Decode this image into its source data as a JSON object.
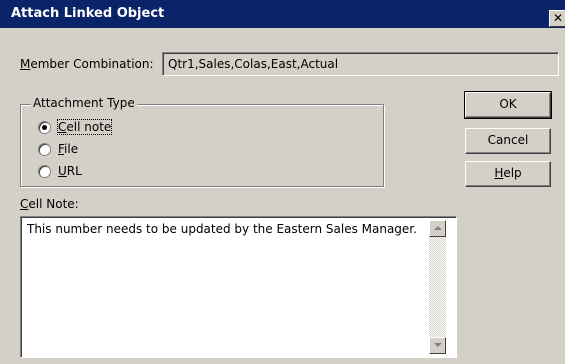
{
  "window": {
    "title": "Attach Linked Object",
    "close_glyph": "✕"
  },
  "member": {
    "label_mnemonic": "M",
    "label_rest": "ember Combination:",
    "value": "Qtr1,Sales,Colas,East,Actual"
  },
  "attachment": {
    "group_label": "Attachment Type",
    "options": [
      {
        "mnemonic": "C",
        "rest": "ell note",
        "selected": true
      },
      {
        "mnemonic": "F",
        "rest": "ile",
        "selected": false
      },
      {
        "mnemonic": "U",
        "rest": "RL",
        "selected": false
      }
    ]
  },
  "buttons": {
    "ok": "OK",
    "cancel": "Cancel",
    "help_mnemonic": "H",
    "help_rest": "elp"
  },
  "note": {
    "label_mnemonic": "C",
    "label_rest": "ell Note:",
    "text": "This number needs to be updated by the Eastern Sales Manager."
  },
  "icons": {
    "close": "close-icon",
    "scroll_up": "scroll-up-arrow-icon",
    "scroll_down": "scroll-down-arrow-icon"
  }
}
